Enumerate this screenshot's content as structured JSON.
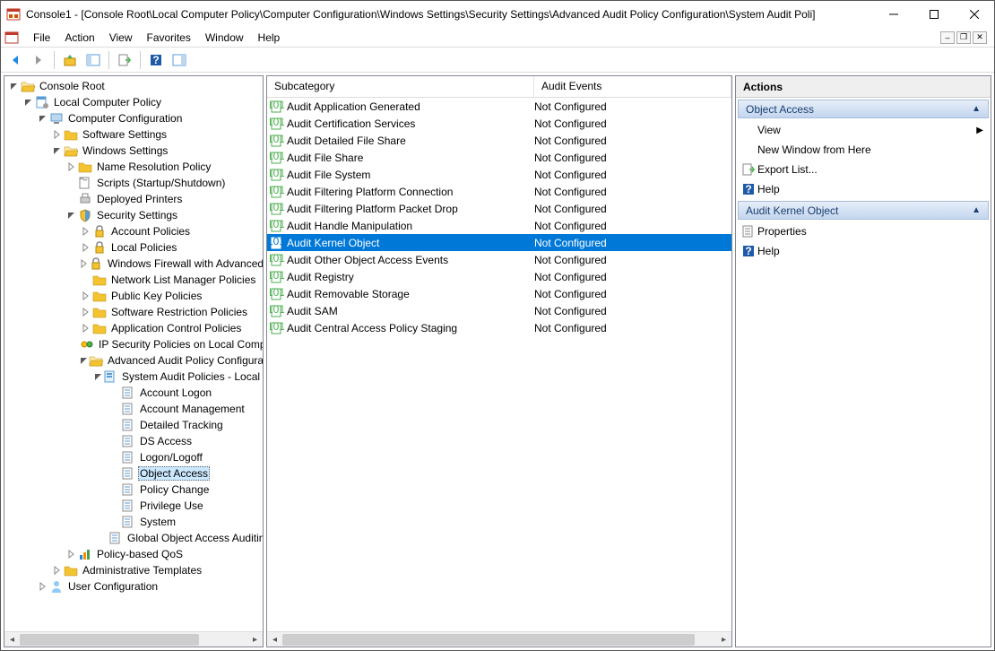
{
  "window": {
    "title": "Console1 - [Console Root\\Local Computer Policy\\Computer Configuration\\Windows Settings\\Security Settings\\Advanced Audit Policy Configuration\\System Audit Poli]"
  },
  "menus": {
    "file": "File",
    "action": "Action",
    "view": "View",
    "favorites": "Favorites",
    "window": "Window",
    "help": "Help"
  },
  "tree": {
    "root": "Console Root",
    "lcp": "Local Computer Policy",
    "cc": "Computer Configuration",
    "ss": "Software Settings",
    "ws": "Windows Settings",
    "nrp": "Name Resolution Policy",
    "scripts": "Scripts (Startup/Shutdown)",
    "dp": "Deployed Printers",
    "sec": "Security Settings",
    "ap": "Account Policies",
    "lp": "Local Policies",
    "wf": "Windows Firewall with Advanced Security",
    "nlm": "Network List Manager Policies",
    "pkp": "Public Key Policies",
    "srp": "Software Restriction Policies",
    "acp": "Application Control Policies",
    "ips": "IP Security Policies on Local Computer",
    "aapc": "Advanced Audit Policy Configuration",
    "sap": "System Audit Policies - Local Group Policy Object",
    "al": "Account Logon",
    "am": "Account Management",
    "dt": "Detailed Tracking",
    "ds": "DS Access",
    "ll": "Logon/Logoff",
    "oa": "Object Access",
    "pc": "Policy Change",
    "pu": "Privilege Use",
    "sys": "System",
    "goaa": "Global Object Access Auditing",
    "pbq": "Policy-based QoS",
    "at": "Administrative Templates",
    "uc": "User Configuration"
  },
  "list": {
    "headers": {
      "c1": "Subcategory",
      "c2": "Audit Events"
    },
    "rows": [
      {
        "name": "Audit Application Generated",
        "status": "Not Configured"
      },
      {
        "name": "Audit Certification Services",
        "status": "Not Configured"
      },
      {
        "name": "Audit Detailed File Share",
        "status": "Not Configured"
      },
      {
        "name": "Audit File Share",
        "status": "Not Configured"
      },
      {
        "name": "Audit File System",
        "status": "Not Configured"
      },
      {
        "name": "Audit Filtering Platform Connection",
        "status": "Not Configured"
      },
      {
        "name": "Audit Filtering Platform Packet Drop",
        "status": "Not Configured"
      },
      {
        "name": "Audit Handle Manipulation",
        "status": "Not Configured"
      },
      {
        "name": "Audit Kernel Object",
        "status": "Not Configured",
        "selected": true
      },
      {
        "name": "Audit Other Object Access Events",
        "status": "Not Configured"
      },
      {
        "name": "Audit Registry",
        "status": "Not Configured"
      },
      {
        "name": "Audit Removable Storage",
        "status": "Not Configured"
      },
      {
        "name": "Audit SAM",
        "status": "Not Configured"
      },
      {
        "name": "Audit Central Access Policy Staging",
        "status": "Not Configured"
      }
    ]
  },
  "actions": {
    "title": "Actions",
    "sec1": "Object Access",
    "view": "View",
    "newwin": "New Window from Here",
    "export": "Export List...",
    "help": "Help",
    "sec2": "Audit Kernel Object",
    "props": "Properties"
  }
}
